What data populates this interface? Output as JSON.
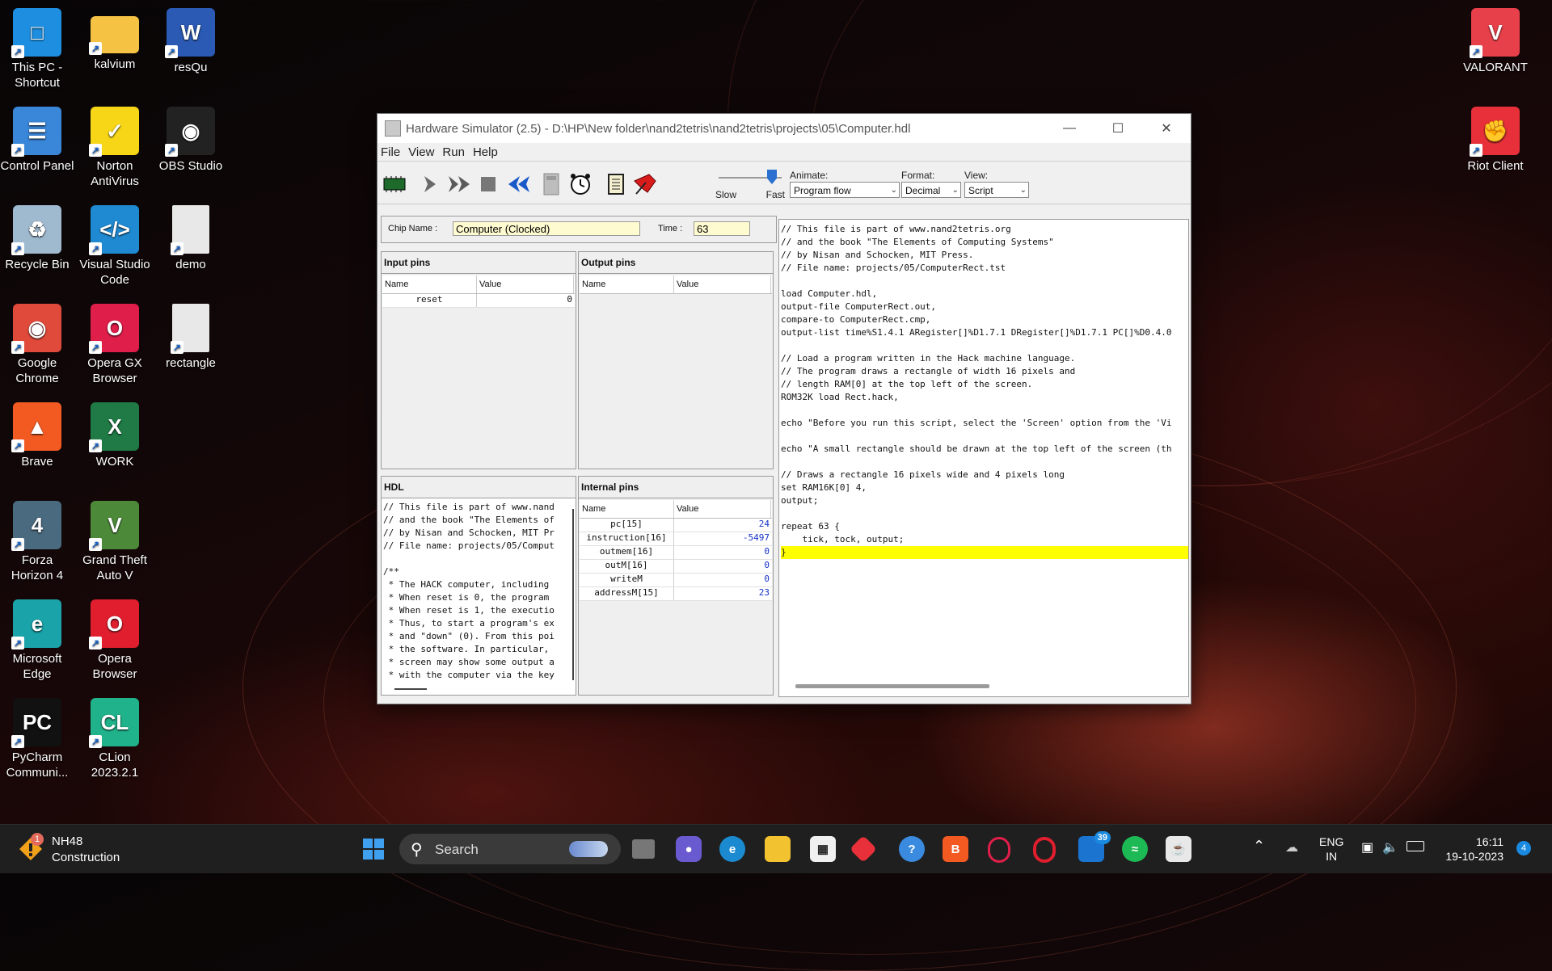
{
  "desktop": {
    "icons": [
      {
        "label": "This PC -\nShortcut",
        "icon": "monitor-icon",
        "color": "#1e8fe0"
      },
      {
        "label": "kalvium",
        "icon": "folder-icon",
        "color": "#f5c244"
      },
      {
        "label": "resQu",
        "icon": "word-document-icon",
        "color": "#2b5ab5"
      },
      {
        "label": "Control Panel",
        "icon": "control-panel-icon",
        "color": "#3a86d8"
      },
      {
        "label": "Norton\nAntiVirus",
        "icon": "norton-icon",
        "color": "#f7d617"
      },
      {
        "label": "OBS Studio",
        "icon": "obs-icon",
        "color": "#222222"
      },
      {
        "label": "Recycle Bin",
        "icon": "recycle-bin-icon",
        "color": "#9fb9cf"
      },
      {
        "label": "Visual Studio\nCode",
        "icon": "vscode-icon",
        "color": "#1f8ad2"
      },
      {
        "label": "demo",
        "icon": "text-file-icon",
        "color": "#e8e8e8"
      },
      {
        "label": "Google\nChrome",
        "icon": "chrome-icon",
        "color": "#e04a3a"
      },
      {
        "label": "Opera GX\nBrowser",
        "icon": "opera-gx-icon",
        "color": "#e01e4a"
      },
      {
        "label": "rectangle",
        "icon": "text-file-icon",
        "color": "#e8e8e8"
      },
      {
        "label": "Brave",
        "icon": "brave-icon",
        "color": "#f25a22"
      },
      {
        "label": "WORK",
        "icon": "excel-icon",
        "color": "#1f7a45"
      },
      {
        "label": "Forza\nHorizon 4",
        "icon": "forza-icon",
        "color": "#4a6a80"
      },
      {
        "label": "Grand Theft\nAuto V",
        "icon": "gta-icon",
        "color": "#4c8a3a"
      },
      {
        "label": "Microsoft\nEdge",
        "icon": "edge-icon",
        "color": "#1aa3a8"
      },
      {
        "label": "Opera\nBrowser",
        "icon": "opera-icon",
        "color": "#e01e2e"
      },
      {
        "label": "PyCharm\nCommuni...",
        "icon": "pycharm-icon",
        "color": "#111111"
      },
      {
        "label": "CLion\n2023.2.1",
        "icon": "clion-icon",
        "color": "#20b28a"
      },
      {
        "label": "VALORANT",
        "icon": "valorant-icon",
        "color": "#e8404a"
      },
      {
        "label": "Riot Client",
        "icon": "riot-client-icon",
        "color": "#e8303a"
      }
    ]
  },
  "window": {
    "title": "Hardware Simulator (2.5) - D:\\HP\\New folder\\nand2tetris\\nand2tetris\\projects\\05\\Computer.hdl",
    "menu": [
      "File",
      "View",
      "Run",
      "Help"
    ],
    "toolbar": {
      "speed_slow": "Slow",
      "speed_fast": "Fast",
      "animate_label": "Animate:",
      "animate_value": "Program flow",
      "format_label": "Format:",
      "format_value": "Decimal",
      "view_label": "View:",
      "view_value": "Script"
    },
    "chip_name_label": "Chip Name :",
    "chip_name_value": "Computer (Clocked)",
    "time_label": "Time :",
    "time_value": "63",
    "input_pins": {
      "title": "Input pins",
      "col_name": "Name",
      "col_value": "Value",
      "rows": [
        {
          "name": "reset",
          "value": "0"
        }
      ]
    },
    "output_pins": {
      "title": "Output pins",
      "col_name": "Name",
      "col_value": "Value"
    },
    "hdl": {
      "title": "HDL",
      "lines": [
        "// This file is part of www.nand",
        "// and the book \"The Elements of",
        "// by Nisan and Schocken, MIT Pr",
        "// File name: projects/05/Comput",
        "",
        "/**",
        " * The HACK computer, including ",
        " * When reset is 0, the program ",
        " * When reset is 1, the executio",
        " * Thus, to start a program's ex",
        " * and \"down\" (0). From this poi",
        " * the software. In particular, ",
        " * screen may show some output a",
        " * with the computer via the key"
      ]
    },
    "internal_pins": {
      "title": "Internal pins",
      "col_name": "Name",
      "col_value": "Value",
      "rows": [
        {
          "name": "pc[15]",
          "value": "24"
        },
        {
          "name": "instruction[16]",
          "value": "-5497"
        },
        {
          "name": "outmem[16]",
          "value": "0"
        },
        {
          "name": "outM[16]",
          "value": "0"
        },
        {
          "name": "writeM",
          "value": "0"
        },
        {
          "name": "addressM[15]",
          "value": "23"
        }
      ]
    },
    "script": {
      "lines": [
        "// This file is part of www.nand2tetris.org",
        "// and the book \"The Elements of Computing Systems\"",
        "// by Nisan and Schocken, MIT Press.",
        "// File name: projects/05/ComputerRect.tst",
        "",
        "load Computer.hdl,",
        "output-file ComputerRect.out,",
        "compare-to ComputerRect.cmp,",
        "output-list time%S1.4.1 ARegister[]%D1.7.1 DRegister[]%D1.7.1 PC[]%D0.4.0",
        "",
        "// Load a program written in the Hack machine language.",
        "// The program draws a rectangle of width 16 pixels and",
        "// length RAM[0] at the top left of the screen.",
        "ROM32K load Rect.hack,",
        "",
        "echo \"Before you run this script, select the 'Screen' option from the 'Vi",
        "",
        "echo \"A small rectangle should be drawn at the top left of the screen (th",
        "",
        "// Draws a rectangle 16 pixels wide and 4 pixels long",
        "set RAM16K[0] 4,",
        "output;",
        "",
        "repeat 63 {",
        "    tick, tock, output;",
        "}"
      ],
      "highlight_line": 25,
      "highlight_color": "#ffff00"
    }
  },
  "taskbar": {
    "weather_badge": "1",
    "weather_title": "NH48",
    "weather_subtitle": "Construction",
    "search_label": "Search",
    "store_badge": "",
    "mail_badge": "39",
    "lang_top": "ENG",
    "lang_bottom": "IN",
    "time": "16:11",
    "date": "19-10-2023",
    "notification_count": "4"
  }
}
